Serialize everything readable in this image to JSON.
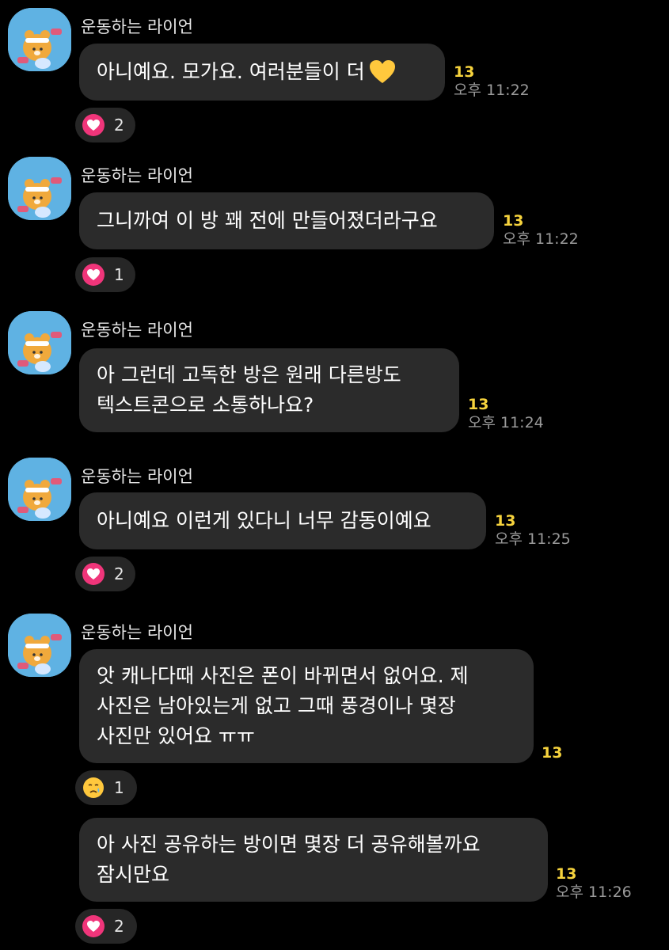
{
  "sender_name": "운동하는 라이언",
  "messages": [
    {
      "text": "아니예요. 모가요. 여러분들이 더",
      "has_heart_emoji": true,
      "unread": "13",
      "time": "오후 11:22",
      "reaction": {
        "icon": "heart",
        "count": "2"
      }
    },
    {
      "text": "그니까여 이 방 꽤 전에 만들어졌더라구요",
      "unread": "13",
      "time": "오후 11:22",
      "reaction": {
        "icon": "heart",
        "count": "1"
      }
    },
    {
      "text": "아 그런데 고독한 방은 원래 다른방도\n텍스트콘으로 소통하나요?",
      "unread": "13",
      "time": "오후 11:24"
    },
    {
      "text": "아니예요 이런게 있다니 너무 감동이예요",
      "unread": "13",
      "time": "오후 11:25",
      "reaction": {
        "icon": "heart",
        "count": "2"
      }
    },
    {
      "text": "앗 캐나다때 사진은 폰이 바뀌면서 없어요. 제\n사진은 남아있는게 없고 그때 풍경이나 몇장\n사진만 있어요 ㅠㅠ",
      "unread": "13",
      "reaction": {
        "icon": "crying-face",
        "count": "1"
      }
    },
    {
      "text": "아 사진 공유하는 방이면 몇장 더 공유해볼까요\n잠시만요",
      "unread": "13",
      "time": "오후 11:26",
      "reaction": {
        "icon": "heart",
        "count": "2"
      }
    }
  ],
  "colors": {
    "background": "#000000",
    "bubble": "#2b2b2b",
    "unread": "#f6d33d",
    "time": "#9a9a9a",
    "heart_reaction": "#f0357a",
    "avatar_bg": "#5fb2e3"
  }
}
